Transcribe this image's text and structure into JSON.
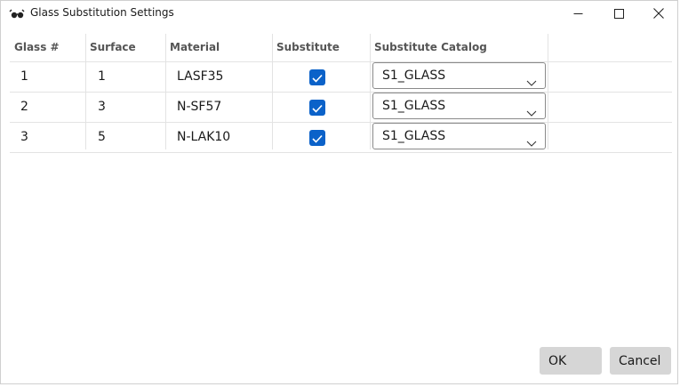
{
  "window": {
    "title": "Glass Substitution Settings",
    "icons": {
      "app": "glasses-icon",
      "minimize": "minimize-icon",
      "maximize": "maximize-icon",
      "close": "close-icon"
    }
  },
  "grid": {
    "headers": [
      "Glass #",
      "Surface",
      "Material",
      "Substitute",
      "Substitute Catalog"
    ],
    "rows": [
      {
        "glass": "1",
        "surface": "1",
        "material": "LASF35",
        "substitute": true,
        "catalog": "S1_GLASS"
      },
      {
        "glass": "2",
        "surface": "3",
        "material": "N-SF57",
        "substitute": true,
        "catalog": "S1_GLASS"
      },
      {
        "glass": "3",
        "surface": "5",
        "material": "N-LAK10",
        "substitute": true,
        "catalog": "S1_GLASS"
      }
    ]
  },
  "buttons": {
    "ok": "OK",
    "cancel": "Cancel"
  },
  "colors": {
    "checkbox": "#0b62c9",
    "button": "#d6d6d6",
    "gridline": "#e3e3e3"
  }
}
